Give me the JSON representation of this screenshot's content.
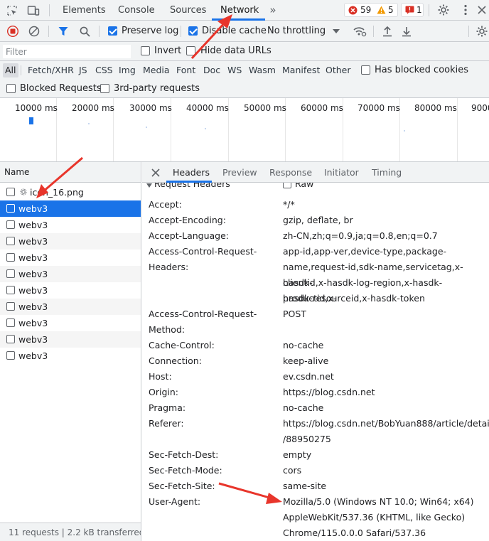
{
  "tabs": [
    {
      "label": "Elements"
    },
    {
      "label": "Console"
    },
    {
      "label": "Sources"
    },
    {
      "label": "Network"
    }
  ],
  "badges": {
    "errors": "59",
    "warnings": "5",
    "issues": "1"
  },
  "toolbar": {
    "preserve_log": "Preserve log",
    "disable_cache": "Disable cache",
    "throttling": "No throttling"
  },
  "filter": {
    "placeholder": "Filter",
    "invert": "Invert",
    "hide_data_urls": "Hide data URLs"
  },
  "types": [
    "All",
    "Fetch/XHR",
    "JS",
    "CSS",
    "Img",
    "Media",
    "Font",
    "Doc",
    "WS",
    "Wasm",
    "Manifest",
    "Other"
  ],
  "blocked_cookies": "Has blocked cookies",
  "blocked_requests": "Blocked Requests",
  "third_party": "3rd-party requests",
  "timeline": [
    "10000 ms",
    "20000 ms",
    "30000 ms",
    "40000 ms",
    "50000 ms",
    "60000 ms",
    "70000 ms",
    "80000 ms",
    "9000"
  ],
  "list": {
    "header": "Name",
    "rows": [
      "icon_16.png",
      "webv3",
      "webv3",
      "webv3",
      "webv3",
      "webv3",
      "webv3",
      "webv3",
      "webv3",
      "webv3",
      "webv3"
    ],
    "status": "11 requests  |  2.2 kB transferred"
  },
  "detail_tabs": [
    "Headers",
    "Preview",
    "Response",
    "Initiator",
    "Timing"
  ],
  "section": {
    "title": "Request Headers",
    "raw": "Raw"
  },
  "headers": [
    {
      "key": "Accept:",
      "value": "*/*"
    },
    {
      "key": "Accept-Encoding:",
      "value": "gzip, deflate, br"
    },
    {
      "key": "Accept-Language:",
      "value": "zh-CN,zh;q=0.9,ja;q=0.8,en;q=0.7"
    },
    {
      "key": "Access-Control-Request-",
      "key2": "Headers:",
      "value": "app-id,app-ver,device-type,package-",
      "value2": "name,request-id,sdk-name,servicetag,x-hasdk-",
      "value3": "clientid,x-hasdk-log-region,x-hasdk-productid,x-",
      "value4": "hasdk-resourceid,x-hasdk-token"
    },
    {
      "key": "Access-Control-Request-",
      "key2": "Method:",
      "value": "POST"
    },
    {
      "key": "Cache-Control:",
      "value": "no-cache"
    },
    {
      "key": "Connection:",
      "value": "keep-alive"
    },
    {
      "key": "Host:",
      "value": "ev.csdn.net"
    },
    {
      "key": "Origin:",
      "value": "https://blog.csdn.net"
    },
    {
      "key": "Pragma:",
      "value": "no-cache"
    },
    {
      "key": "Referer:",
      "value": "https://blog.csdn.net/BobYuan888/article/details",
      "value2": "/88950275"
    },
    {
      "key": "Sec-Fetch-Dest:",
      "value": "empty"
    },
    {
      "key": "Sec-Fetch-Mode:",
      "value": "cors"
    },
    {
      "key": "Sec-Fetch-Site:",
      "value": "same-site"
    },
    {
      "key": "User-Agent:",
      "value": "Mozilla/5.0 (Windows NT 10.0; Win64; x64)",
      "value2": "AppleWebKit/537.36 (KHTML, like Gecko)",
      "value3": "Chrome/115.0.0.0 Safari/537.36"
    }
  ],
  "colors": {
    "accent": "#1a73e8",
    "error": "#d93025",
    "warning": "#f29900",
    "arrow": "#e8352b"
  }
}
